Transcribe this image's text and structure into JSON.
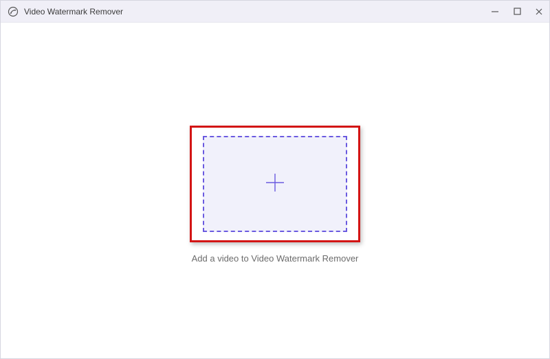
{
  "titlebar": {
    "app_name": "Video Watermark Remover"
  },
  "main": {
    "drop_caption": "Add a video to Video Watermark Remover"
  },
  "icons": {
    "app": "app-circle-icon",
    "minimize": "minimize-icon",
    "maximize": "maximize-icon",
    "close": "close-icon",
    "plus": "plus-icon"
  },
  "colors": {
    "accent": "#6a5ae0",
    "highlight_border": "#d31414",
    "titlebar_bg": "#f0eff7",
    "dropzone_bg": "#f1f1fb"
  }
}
